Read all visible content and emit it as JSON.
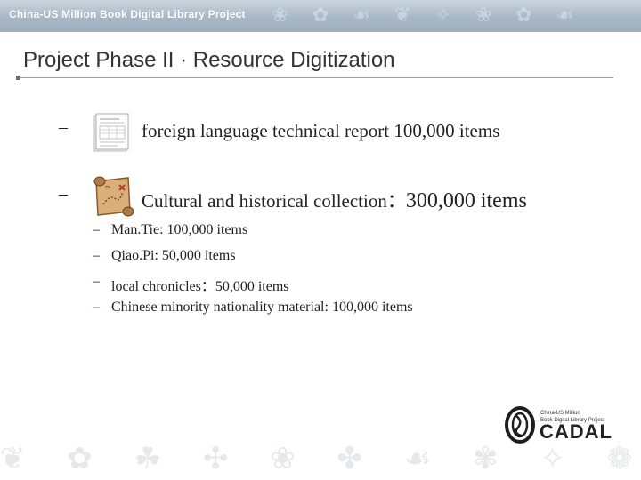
{
  "header": {
    "title": "China-US Million Book Digital Library Project",
    "background_color": "#a9b8c6"
  },
  "slide": {
    "title": "Project Phase II · Resource Digitization"
  },
  "items": [
    {
      "bullet": "–",
      "icon": "document-icon",
      "text": "foreign language technical report   100,000 items"
    },
    {
      "bullet": "–",
      "icon": "map-scroll-icon",
      "text_main": "Cultural and historical collection：",
      "text_count": "300,000 items",
      "subitems": [
        {
          "bullet": "–",
          "text": "Man.Tie: 100,000 items"
        },
        {
          "bullet": "–",
          "text": "Qiao.Pi:  50,000 items"
        },
        {
          "bullet": "–",
          "text": "local chronicles：50,000 items"
        },
        {
          "bullet": "–",
          "text": "Chinese minority nationality material: 100,000 items"
        }
      ]
    }
  ],
  "logo": {
    "caption_line1": "China-US Million",
    "caption_line2": "Book Digital Library Project",
    "name": "CADAL",
    "icon": "cadal-logo-icon"
  }
}
